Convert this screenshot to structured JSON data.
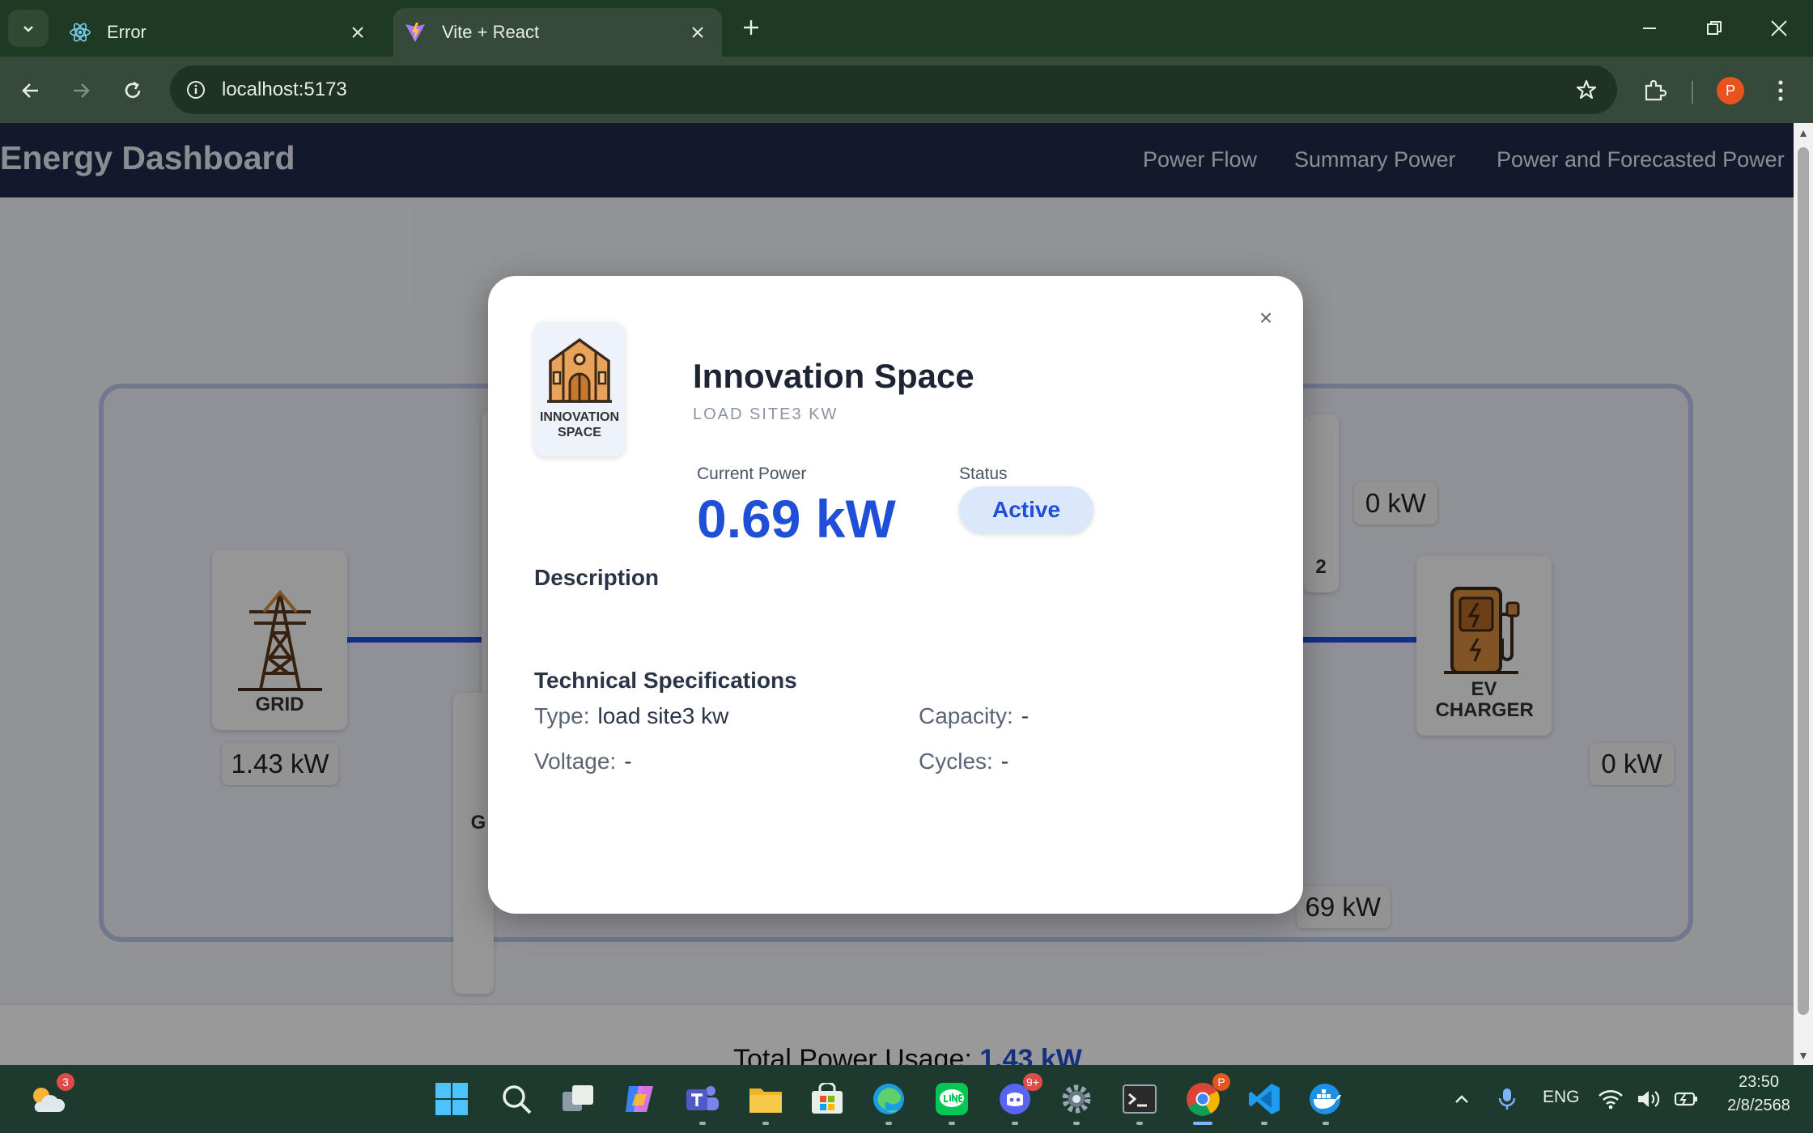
{
  "browser": {
    "tabs": [
      {
        "title": "Error",
        "icon": "react-icon"
      },
      {
        "title": "Vite + React",
        "icon": "vite-icon"
      }
    ],
    "url": "localhost:5173",
    "profile_initial": "P"
  },
  "app": {
    "title": "Energy Dashboard",
    "nav": [
      "Power Flow",
      "Summary Power",
      "Power and Forecasted Power"
    ]
  },
  "flow": {
    "nodes": {
      "grid": {
        "label": "GRID",
        "value": "1.43 kW"
      },
      "ev_charger": {
        "label": "EV CHARGER",
        "value": "0 kW"
      },
      "top_right_value": "0 kW",
      "lower_right_value": "69 kW",
      "partial_labels": {
        "left_small": "G",
        "right_small": "2"
      }
    },
    "total_label": "Total Power Usage:",
    "total_value": "1.43 kW"
  },
  "modal": {
    "icon_label_line1": "INNOVATION",
    "icon_label_line2": "SPACE",
    "title": "Innovation Space",
    "subtitle": "LOAD SITE3 KW",
    "current_power_label": "Current Power",
    "current_power_value": "0.69 kW",
    "status_label": "Status",
    "status_value": "Active",
    "description_title": "Description",
    "specs_title": "Technical Specifications",
    "specs": {
      "type_label": "Type:",
      "type_value": "load site3 kw",
      "capacity_label": "Capacity:",
      "capacity_value": "-",
      "voltage_label": "Voltage:",
      "voltage_value": "-",
      "cycles_label": "Cycles:",
      "cycles_value": "-"
    },
    "close_symbol": "×"
  },
  "taskbar": {
    "weather_badge": "3",
    "discord_badge": "9+",
    "chrome_badge": "P",
    "language": "ENG",
    "time": "23:50",
    "date": "2/8/2568"
  },
  "colors": {
    "accent_blue": "#1f4fd6",
    "header_navy": "#1e2a4a",
    "chrome_green": "#1f3a24"
  }
}
